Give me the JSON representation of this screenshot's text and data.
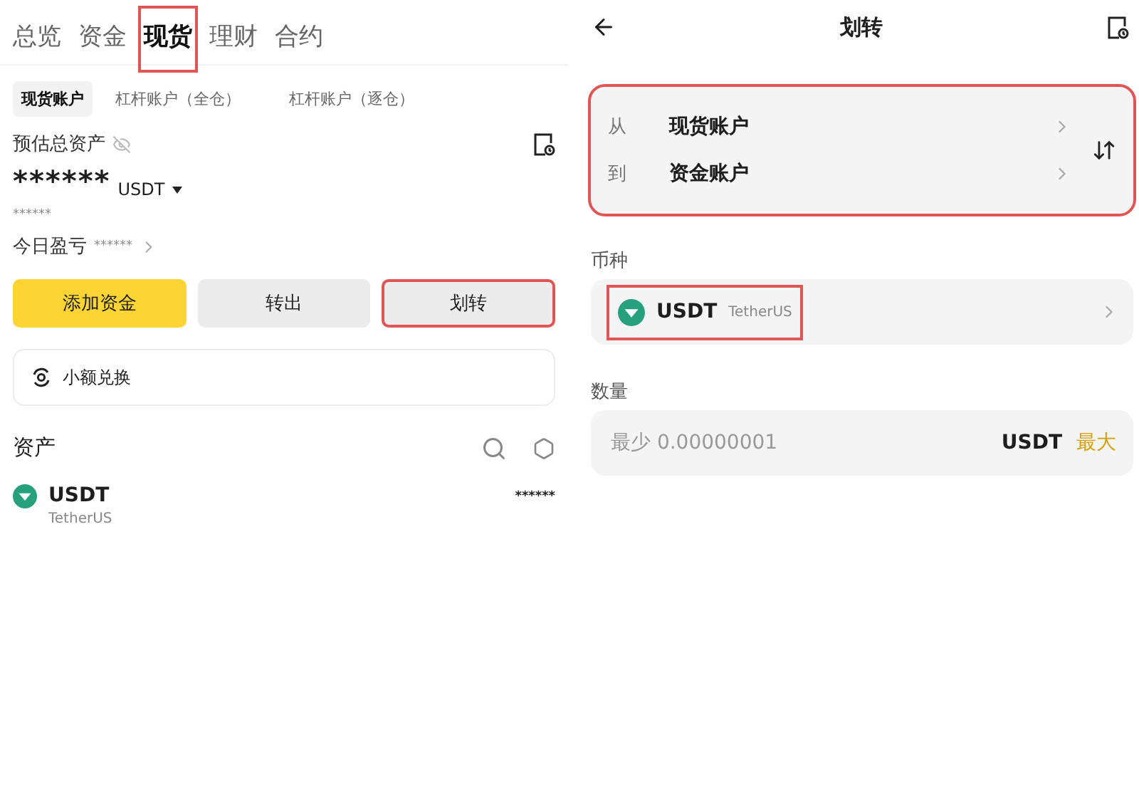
{
  "overview": {
    "tabs": [
      {
        "label": "总览",
        "selected": false,
        "highlighted": false
      },
      {
        "label": "资金",
        "selected": false,
        "highlighted": false
      },
      {
        "label": "现货",
        "selected": true,
        "highlighted": true
      },
      {
        "label": "理财",
        "selected": false,
        "highlighted": false
      },
      {
        "label": "合约",
        "selected": false,
        "highlighted": false
      }
    ],
    "subtabs": [
      {
        "label": "现货账户",
        "selected": true
      },
      {
        "label": "杠杆账户（全仓）",
        "selected": false
      },
      {
        "label": "杠杆账户（逐仓）",
        "selected": false
      }
    ],
    "estimate_label": "预估总资产",
    "balance": "******",
    "currency": "USDT",
    "balance_fiat": "******",
    "pnl_label": "今日盈亏",
    "pnl_value": "******",
    "actions": [
      {
        "label": "添加资金",
        "kind": "primary",
        "highlighted": false
      },
      {
        "label": "转出",
        "kind": "secondary",
        "highlighted": false
      },
      {
        "label": "划转",
        "kind": "secondary",
        "highlighted": true
      }
    ],
    "small_exchange": "小额兑换",
    "assets_title": "资产",
    "assets": [
      {
        "symbol": "USDT",
        "name": "TetherUS",
        "amount": "******"
      }
    ]
  },
  "transfer": {
    "title": "划转",
    "accounts": {
      "highlighted": true,
      "rows": [
        {
          "label": "从",
          "account": "现货账户"
        },
        {
          "label": "到",
          "account": "资金账户"
        }
      ]
    },
    "coin_label": "币种",
    "coin": {
      "symbol": "USDT",
      "name": "TetherUS",
      "highlighted": true
    },
    "amount_label": "数量",
    "amount": {
      "placeholder": "最少 0.00000001",
      "unit": "USDT",
      "max": "最大"
    }
  }
}
